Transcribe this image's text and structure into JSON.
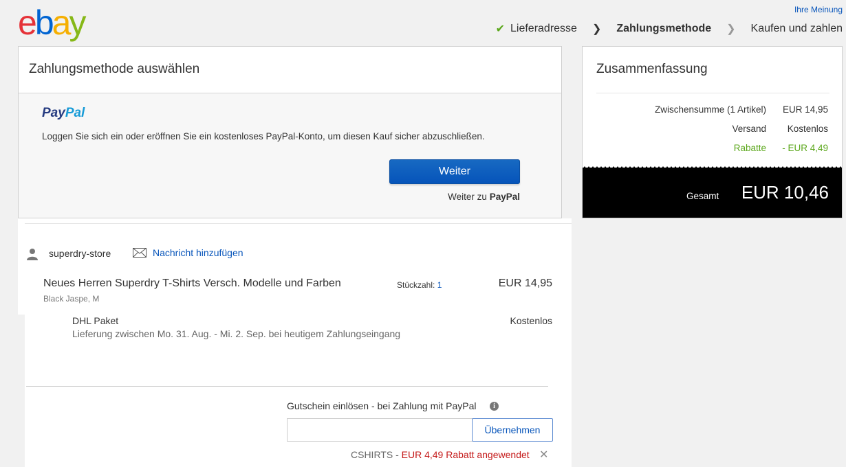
{
  "header": {
    "logo": [
      "e",
      "b",
      "a",
      "y"
    ],
    "logo_colors": [
      "#e53238",
      "#0064d2",
      "#f5af02",
      "#86b817"
    ],
    "feedback_link": "Ihre Meinung",
    "steps": [
      "Lieferadresse",
      "Zahlungsmethode",
      "Kaufen und zahlen"
    ],
    "step_done_icon": "check-icon",
    "step_separator": "❯"
  },
  "payment": {
    "title": "Zahlungsmethode auswählen",
    "paypal_logo": [
      "Pay",
      "Pal"
    ],
    "paypal_colors": [
      "#253b80",
      "#179bd7"
    ],
    "description": "Loggen Sie sich ein oder eröffnen Sie ein kostenloses PayPal-Konto, um diesen Kauf sicher abzuschließen.",
    "continue_button": "Weiter",
    "continue_sub_prefix": "Weiter zu",
    "continue_sub_brand": "PayPal"
  },
  "order": {
    "seller": "superdry-store",
    "seller_icon": "user-icon",
    "message_icon": "mail-icon",
    "message_link": "Nachricht hinzufügen",
    "item": {
      "title": "Neues Herren Superdry T-Shirts Versch. Modelle und Farben",
      "variant": "Black Jaspe, M",
      "qty_label": "Stückzahl:",
      "qty": "1",
      "price": "EUR 14,95"
    },
    "shipping": {
      "name": "DHL Paket",
      "delivery": "Lieferung zwischen Mo. 31. Aug. - Mi. 2. Sep. bei heutigem Zahlungseingang",
      "cost": "Kostenlos"
    },
    "coupon": {
      "label": "Gutschein einlösen - bei Zahlung mit PayPal",
      "info_icon": "info-icon",
      "input_value": "",
      "apply_button": "Übernehmen",
      "applied_code": "CSHIRTS -",
      "applied_text": "EUR 4,49 Rabatt angewendet",
      "remove_icon": "close-icon"
    }
  },
  "summary": {
    "title": "Zusammenfassung",
    "rows": [
      {
        "label": "Zwischensumme (1 Artikel)",
        "value": "EUR 14,95"
      },
      {
        "label": "Versand",
        "value": "Kostenlos"
      },
      {
        "label": "Rabatte",
        "value": "- EUR 4,49"
      }
    ],
    "discount_color": "#5ba71b",
    "total_label": "Gesamt",
    "total_value": "EUR 10,46"
  }
}
